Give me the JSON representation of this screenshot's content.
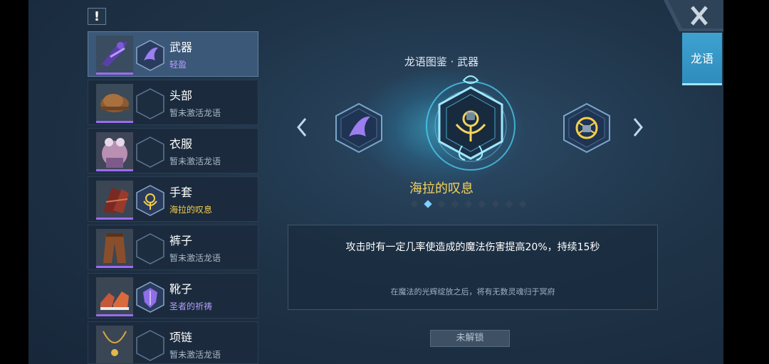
{
  "alert_icon": "!",
  "title": "龙语图鉴 · 武器",
  "side_tab": "龙语",
  "items": [
    {
      "name": "武器",
      "status": "轻盈",
      "status_color": "#b69cff",
      "icon": "purple-wing-emblem",
      "selected": true
    },
    {
      "name": "头部",
      "status": "暂未激活龙语",
      "status_color": "#aab8c6",
      "icon": "empty-hex"
    },
    {
      "name": "衣服",
      "status": "暂未激活龙语",
      "status_color": "#aab8c6",
      "icon": "empty-hex"
    },
    {
      "name": "手套",
      "status": "海拉的叹息",
      "status_color": "#f4cf4b",
      "icon": "gold-hela-emblem"
    },
    {
      "name": "裤子",
      "status": "暂未激活龙语",
      "status_color": "#aab8c6",
      "icon": "empty-hex"
    },
    {
      "name": "靴子",
      "status": "圣者的祈祷",
      "status_color": "#b69cff",
      "icon": "purple-shield-emblem"
    },
    {
      "name": "项链",
      "status": "暂未激活龙语",
      "status_color": "#aab8c6",
      "icon": "empty-hex"
    }
  ],
  "emblem_name": "海拉的叹息",
  "carousel": {
    "total": 9,
    "active_index": 1
  },
  "description": {
    "effect": "攻击时有一定几率使造成的魔法伤害提高20%，持续15秒",
    "lore": "在魔法的光辉绽放之后，将有无数灵魂归于冥府"
  },
  "unlock_button": "未解锁",
  "colors": {
    "accent": "#3ea2cf",
    "gold": "#f6d35b",
    "purple": "#b69cff"
  }
}
